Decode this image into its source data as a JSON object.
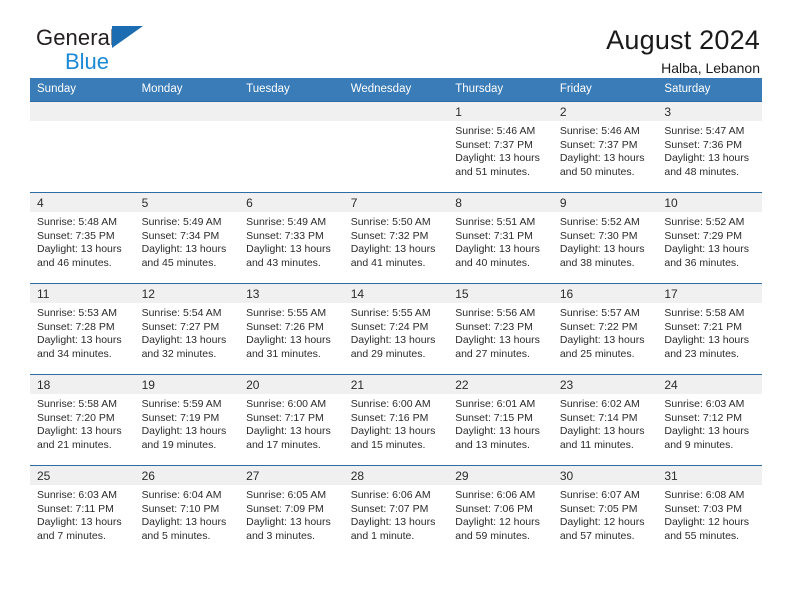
{
  "brand": {
    "name_part1": "General",
    "name_part2": "Blue",
    "logo_icon": "triangle-logo-icon"
  },
  "header": {
    "title": "August 2024",
    "subtitle": "Halba, Lebanon"
  },
  "colors": {
    "header_blue": "#3a7cb8",
    "row_border_blue": "#2e6da4",
    "daynum_band": "#f0f0f0",
    "brand_blue": "#1b8ad6",
    "logo_blue": "#1b6cb0"
  },
  "weekdays": [
    "Sunday",
    "Monday",
    "Tuesday",
    "Wednesday",
    "Thursday",
    "Friday",
    "Saturday"
  ],
  "labels": {
    "sunrise": "Sunrise:",
    "sunset": "Sunset:",
    "daylight": "Daylight:"
  },
  "weeks": [
    [
      {
        "day": "",
        "empty": true
      },
      {
        "day": "",
        "empty": true
      },
      {
        "day": "",
        "empty": true
      },
      {
        "day": "",
        "empty": true
      },
      {
        "day": "1",
        "sunrise": "Sunrise: 5:46 AM",
        "sunset": "Sunset: 7:37 PM",
        "daylight": "Daylight: 13 hours and 51 minutes."
      },
      {
        "day": "2",
        "sunrise": "Sunrise: 5:46 AM",
        "sunset": "Sunset: 7:37 PM",
        "daylight": "Daylight: 13 hours and 50 minutes."
      },
      {
        "day": "3",
        "sunrise": "Sunrise: 5:47 AM",
        "sunset": "Sunset: 7:36 PM",
        "daylight": "Daylight: 13 hours and 48 minutes."
      }
    ],
    [
      {
        "day": "4",
        "sunrise": "Sunrise: 5:48 AM",
        "sunset": "Sunset: 7:35 PM",
        "daylight": "Daylight: 13 hours and 46 minutes."
      },
      {
        "day": "5",
        "sunrise": "Sunrise: 5:49 AM",
        "sunset": "Sunset: 7:34 PM",
        "daylight": "Daylight: 13 hours and 45 minutes."
      },
      {
        "day": "6",
        "sunrise": "Sunrise: 5:49 AM",
        "sunset": "Sunset: 7:33 PM",
        "daylight": "Daylight: 13 hours and 43 minutes."
      },
      {
        "day": "7",
        "sunrise": "Sunrise: 5:50 AM",
        "sunset": "Sunset: 7:32 PM",
        "daylight": "Daylight: 13 hours and 41 minutes."
      },
      {
        "day": "8",
        "sunrise": "Sunrise: 5:51 AM",
        "sunset": "Sunset: 7:31 PM",
        "daylight": "Daylight: 13 hours and 40 minutes."
      },
      {
        "day": "9",
        "sunrise": "Sunrise: 5:52 AM",
        "sunset": "Sunset: 7:30 PM",
        "daylight": "Daylight: 13 hours and 38 minutes."
      },
      {
        "day": "10",
        "sunrise": "Sunrise: 5:52 AM",
        "sunset": "Sunset: 7:29 PM",
        "daylight": "Daylight: 13 hours and 36 minutes."
      }
    ],
    [
      {
        "day": "11",
        "sunrise": "Sunrise: 5:53 AM",
        "sunset": "Sunset: 7:28 PM",
        "daylight": "Daylight: 13 hours and 34 minutes."
      },
      {
        "day": "12",
        "sunrise": "Sunrise: 5:54 AM",
        "sunset": "Sunset: 7:27 PM",
        "daylight": "Daylight: 13 hours and 32 minutes."
      },
      {
        "day": "13",
        "sunrise": "Sunrise: 5:55 AM",
        "sunset": "Sunset: 7:26 PM",
        "daylight": "Daylight: 13 hours and 31 minutes."
      },
      {
        "day": "14",
        "sunrise": "Sunrise: 5:55 AM",
        "sunset": "Sunset: 7:24 PM",
        "daylight": "Daylight: 13 hours and 29 minutes."
      },
      {
        "day": "15",
        "sunrise": "Sunrise: 5:56 AM",
        "sunset": "Sunset: 7:23 PM",
        "daylight": "Daylight: 13 hours and 27 minutes."
      },
      {
        "day": "16",
        "sunrise": "Sunrise: 5:57 AM",
        "sunset": "Sunset: 7:22 PM",
        "daylight": "Daylight: 13 hours and 25 minutes."
      },
      {
        "day": "17",
        "sunrise": "Sunrise: 5:58 AM",
        "sunset": "Sunset: 7:21 PM",
        "daylight": "Daylight: 13 hours and 23 minutes."
      }
    ],
    [
      {
        "day": "18",
        "sunrise": "Sunrise: 5:58 AM",
        "sunset": "Sunset: 7:20 PM",
        "daylight": "Daylight: 13 hours and 21 minutes."
      },
      {
        "day": "19",
        "sunrise": "Sunrise: 5:59 AM",
        "sunset": "Sunset: 7:19 PM",
        "daylight": "Daylight: 13 hours and 19 minutes."
      },
      {
        "day": "20",
        "sunrise": "Sunrise: 6:00 AM",
        "sunset": "Sunset: 7:17 PM",
        "daylight": "Daylight: 13 hours and 17 minutes."
      },
      {
        "day": "21",
        "sunrise": "Sunrise: 6:00 AM",
        "sunset": "Sunset: 7:16 PM",
        "daylight": "Daylight: 13 hours and 15 minutes."
      },
      {
        "day": "22",
        "sunrise": "Sunrise: 6:01 AM",
        "sunset": "Sunset: 7:15 PM",
        "daylight": "Daylight: 13 hours and 13 minutes."
      },
      {
        "day": "23",
        "sunrise": "Sunrise: 6:02 AM",
        "sunset": "Sunset: 7:14 PM",
        "daylight": "Daylight: 13 hours and 11 minutes."
      },
      {
        "day": "24",
        "sunrise": "Sunrise: 6:03 AM",
        "sunset": "Sunset: 7:12 PM",
        "daylight": "Daylight: 13 hours and 9 minutes."
      }
    ],
    [
      {
        "day": "25",
        "sunrise": "Sunrise: 6:03 AM",
        "sunset": "Sunset: 7:11 PM",
        "daylight": "Daylight: 13 hours and 7 minutes."
      },
      {
        "day": "26",
        "sunrise": "Sunrise: 6:04 AM",
        "sunset": "Sunset: 7:10 PM",
        "daylight": "Daylight: 13 hours and 5 minutes."
      },
      {
        "day": "27",
        "sunrise": "Sunrise: 6:05 AM",
        "sunset": "Sunset: 7:09 PM",
        "daylight": "Daylight: 13 hours and 3 minutes."
      },
      {
        "day": "28",
        "sunrise": "Sunrise: 6:06 AM",
        "sunset": "Sunset: 7:07 PM",
        "daylight": "Daylight: 13 hours and 1 minute."
      },
      {
        "day": "29",
        "sunrise": "Sunrise: 6:06 AM",
        "sunset": "Sunset: 7:06 PM",
        "daylight": "Daylight: 12 hours and 59 minutes."
      },
      {
        "day": "30",
        "sunrise": "Sunrise: 6:07 AM",
        "sunset": "Sunset: 7:05 PM",
        "daylight": "Daylight: 12 hours and 57 minutes."
      },
      {
        "day": "31",
        "sunrise": "Sunrise: 6:08 AM",
        "sunset": "Sunset: 7:03 PM",
        "daylight": "Daylight: 12 hours and 55 minutes."
      }
    ]
  ]
}
